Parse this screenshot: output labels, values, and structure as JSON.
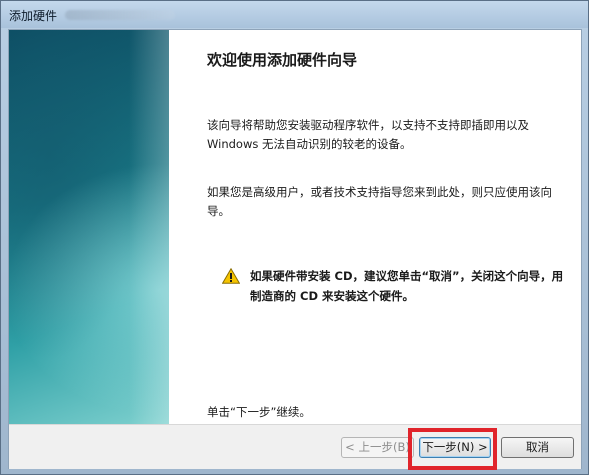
{
  "window": {
    "title": "添加硬件"
  },
  "wizard": {
    "heading": "欢迎使用添加硬件向导",
    "paragraph1": "该向导将帮助您安装驱动程序软件，以支持不支持即插即用以及 Windows 无法自动识别的较老的设备。",
    "paragraph2": "如果您是高级用户，或者技术支持指导您来到此处，则只应使用该向导。",
    "warning": "如果硬件带安装 CD，建议您单击“取消”，关闭这个向导，用制造商的 CD 来安装这个硬件。",
    "hint": "单击“下一步”继续。",
    "warning_icon": "warning-triangle-icon"
  },
  "buttons": {
    "back": "< 上一步(B)",
    "next": "下一步(N) >",
    "cancel": "取消"
  },
  "colors": {
    "highlight": "#e0242b",
    "side_panel": "#17707f"
  }
}
